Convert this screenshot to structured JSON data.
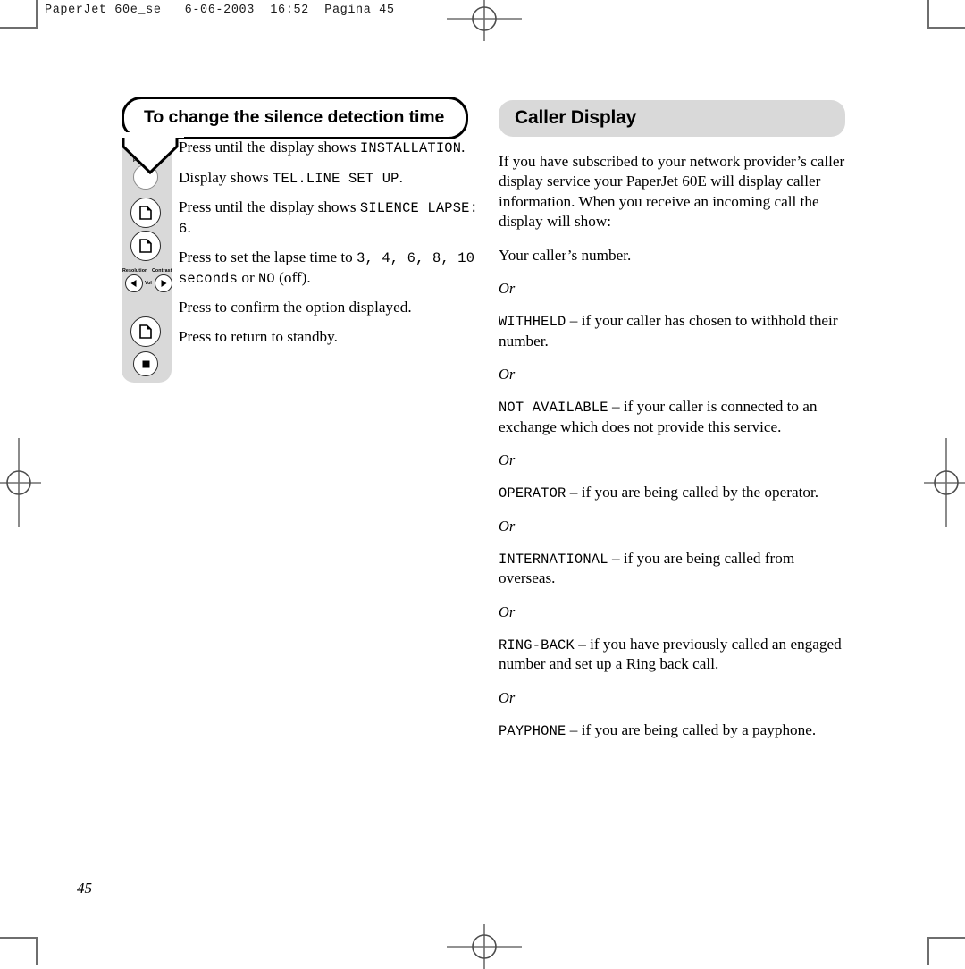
{
  "print_header": "PaperJet 60e_se   6-06-2003  16:52  Pagina 45",
  "folio": "45",
  "left_column": {
    "heading": "To change the silence detection time",
    "panel": {
      "buttons": [
        {
          "name": "function-button",
          "label": "Function",
          "icon": "plain-circle"
        },
        {
          "name": "page-button-1",
          "label": "",
          "icon": "page-icon"
        },
        {
          "name": "page-button-2",
          "label": "",
          "icon": "page-icon"
        },
        {
          "name": "resolution-button",
          "label": "Resolution",
          "icon": "left-arrow-icon"
        },
        {
          "name": "contrast-button",
          "label": "Contrast",
          "icon": "right-arrow-icon"
        },
        {
          "name": "page-button-3",
          "label": "",
          "icon": "page-icon"
        },
        {
          "name": "stop-button",
          "label": "",
          "icon": "stop-square-icon"
        }
      ],
      "vol_label": "Vol"
    },
    "steps": [
      {
        "parts": [
          {
            "t": "Press until the display shows ",
            "lcd": false
          },
          {
            "t": "INSTALLATION",
            "lcd": true
          },
          {
            "t": ".",
            "lcd": false
          }
        ]
      },
      {
        "parts": [
          {
            "t": "Display shows ",
            "lcd": false
          },
          {
            "t": "TEL.LINE SET UP",
            "lcd": true
          },
          {
            "t": ".",
            "lcd": false
          }
        ]
      },
      {
        "parts": [
          {
            "t": "Press until the display shows ",
            "lcd": false
          },
          {
            "t": "SILENCE LAPSE: 6",
            "lcd": true
          },
          {
            "t": ".",
            "lcd": false
          }
        ]
      },
      {
        "parts": [
          {
            "t": "Press to set the lapse time to ",
            "lcd": false
          },
          {
            "t": "3, 4, 6, 8, 10 seconds",
            "lcd": true
          },
          {
            "t": " or ",
            "lcd": false
          },
          {
            "t": "NO",
            "lcd": true
          },
          {
            "t": " (off).",
            "lcd": false
          }
        ]
      },
      {
        "parts": [
          {
            "t": "Press to confirm the option displayed.",
            "lcd": false
          }
        ]
      },
      {
        "parts": [
          {
            "t": "Press to return to standby.",
            "lcd": false
          }
        ]
      }
    ]
  },
  "right_column": {
    "heading": "Caller Display",
    "intro": "If you have subscribed to your network provider’s caller display service your PaperJet 60E will display caller information. When you receive an incoming call the display will show:",
    "first_item": "Your caller’s number.",
    "or_label": "Or",
    "items": [
      {
        "term": "WITHHELD",
        "desc": " – if your caller has chosen to withhold their number."
      },
      {
        "term": "NOT AVAILABLE",
        "desc": " – if your caller is connected to an exchange which does not provide this service."
      },
      {
        "term": "OPERATOR",
        "desc": " – if you are being called by the operator."
      },
      {
        "term": "INTERNATIONAL",
        "desc": " – if you are being called from overseas."
      },
      {
        "term": "RING-BACK",
        "desc": " – if you have previously called an engaged number and set up a Ring back call."
      },
      {
        "term": "PAYPHONE",
        "desc": " – if you are being called by a payphone."
      }
    ]
  },
  "colors": {
    "panel_gray": "#d9d9d9",
    "header_gray": "#d9d9d9",
    "mark_gray": "#6e6e6e",
    "ink": "#000000"
  }
}
